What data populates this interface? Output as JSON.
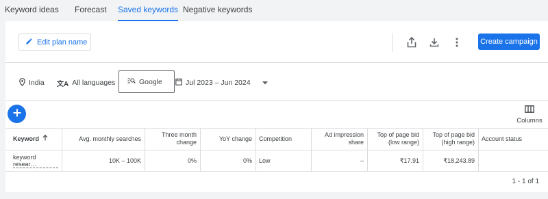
{
  "tabs": [
    {
      "label": "Keyword ideas",
      "active": false
    },
    {
      "label": "Forecast",
      "active": false
    },
    {
      "label": "Saved keywords",
      "active": true
    },
    {
      "label": "Negative keywords",
      "active": false
    }
  ],
  "toolbar": {
    "edit_plan_label": "Edit plan name",
    "create_campaign_label": "Create campaign",
    "icons": [
      "share-icon",
      "download-icon",
      "more-vert-icon"
    ]
  },
  "filters": {
    "location": "India",
    "language": "All languages",
    "network": "Google",
    "date_range": "Jul 2023 – Jun 2024"
  },
  "columns_button_label": "Columns",
  "table": {
    "headers": {
      "keyword": "Keyword",
      "avg_monthly_searches": "Avg. monthly searches",
      "three_month_change": "Three month change",
      "yoy_change": "YoY change",
      "competition": "Competition",
      "ad_impression_share": "Ad impression share",
      "top_bid_low": "Top of page bid (low range)",
      "top_bid_high": "Top of page bid (high range)",
      "account_status": "Account status"
    },
    "rows": [
      {
        "keyword": "keyword resear…",
        "avg_monthly_searches": "10K – 100K",
        "three_month_change": "0%",
        "yoy_change": "0%",
        "competition": "Low",
        "ad_impression_share": "–",
        "top_bid_low": "₹17.91",
        "top_bid_high": "₹18,243.89",
        "account_status": ""
      }
    ]
  },
  "pagination": "1 - 1 of 1",
  "colors": {
    "accent": "#1a73e8",
    "border": "#dadce0",
    "background": "#f1f3f4"
  }
}
